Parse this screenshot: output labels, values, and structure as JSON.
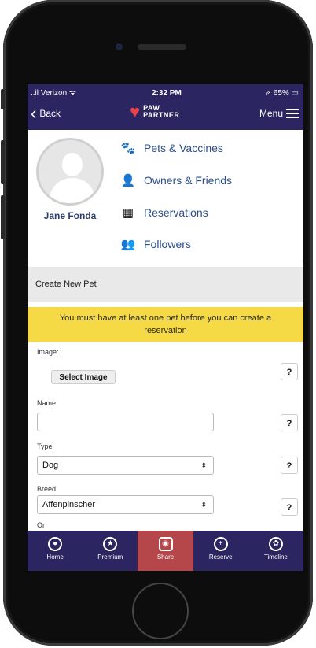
{
  "status_bar": {
    "carrier": "..il Verizon ᯤ",
    "time": "2:32 PM",
    "battery": "⇗ 65% ▭"
  },
  "header": {
    "back_label": "Back",
    "logo_line1": "PAW",
    "logo_line2": "PARTNER",
    "menu_label": "Menu"
  },
  "profile": {
    "name": "Jane Fonda",
    "links": [
      {
        "label": "Pets & Vaccines",
        "icon": "paw-icon"
      },
      {
        "label": "Owners & Friends",
        "icon": "person-icon"
      },
      {
        "label": "Reservations",
        "icon": "calendar-icon"
      },
      {
        "label": "Followers",
        "icon": "group-icon"
      }
    ]
  },
  "section_title": "Create New Pet",
  "warning": "You must have at least one pet before you can create a reservation",
  "form": {
    "image_label": "Image:",
    "select_image_button": "Select Image",
    "name_label": "Name",
    "name_value": "",
    "type_label": "Type",
    "type_value": "Dog",
    "breed_label": "Breed",
    "breed_value": "Affenpinscher",
    "or_label": "Or",
    "help_label": "?"
  },
  "tabbar": {
    "items": [
      {
        "label": "Home",
        "icon": "home-icon"
      },
      {
        "label": "Premium",
        "icon": "star-icon"
      },
      {
        "label": "Share",
        "icon": "camera-icon",
        "active": true
      },
      {
        "label": "Reserve",
        "icon": "plus-icon"
      },
      {
        "label": "Timeline",
        "icon": "paw-icon"
      }
    ]
  },
  "colors": {
    "nav": "#2b2561",
    "active_tab": "#b5464a",
    "warning": "#f5d945",
    "link": "#2c4f8a"
  }
}
